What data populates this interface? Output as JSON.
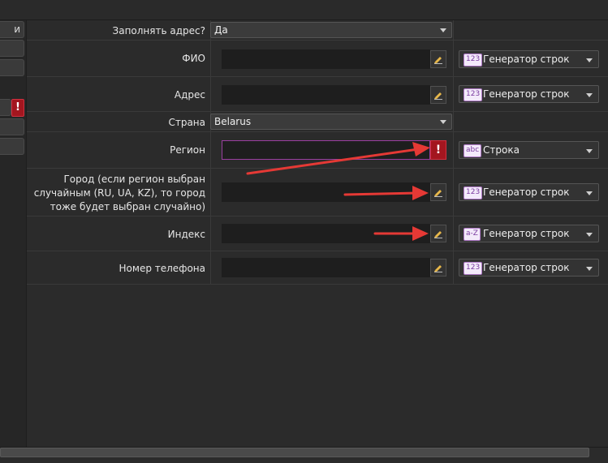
{
  "sidebar": {
    "top_button_label": "и"
  },
  "rows": [
    {
      "label": "Заполнять адрес?",
      "value": "Да"
    },
    {
      "label": "ФИО",
      "generator_badge": "123",
      "generator_label": "Генератор строк"
    },
    {
      "label": "Адрес",
      "generator_badge": "123",
      "generator_label": "Генератор строк"
    },
    {
      "label": "Страна",
      "value": "Belarus"
    },
    {
      "label": "Регион",
      "error_mark": "!",
      "generator_badge": "abc",
      "generator_label": "Строка"
    },
    {
      "label_line1": "Город (если регион выбран",
      "label_line2": "случайным (RU, UA, KZ), то город",
      "label_line3": "тоже будет выбран случайно)",
      "generator_badge": "123",
      "generator_label": "Генератор строк"
    },
    {
      "label": "Индекс",
      "generator_badge": "a-Z",
      "generator_label": "Генератор строк"
    },
    {
      "label": "Номер телефона",
      "generator_badge": "123",
      "generator_label": "Генератор строк"
    }
  ],
  "sidebar_warning": "!",
  "colors": {
    "error": "#a3161f",
    "annotation_arrow": "#e53935",
    "badge_text": "#7a3aa0"
  }
}
